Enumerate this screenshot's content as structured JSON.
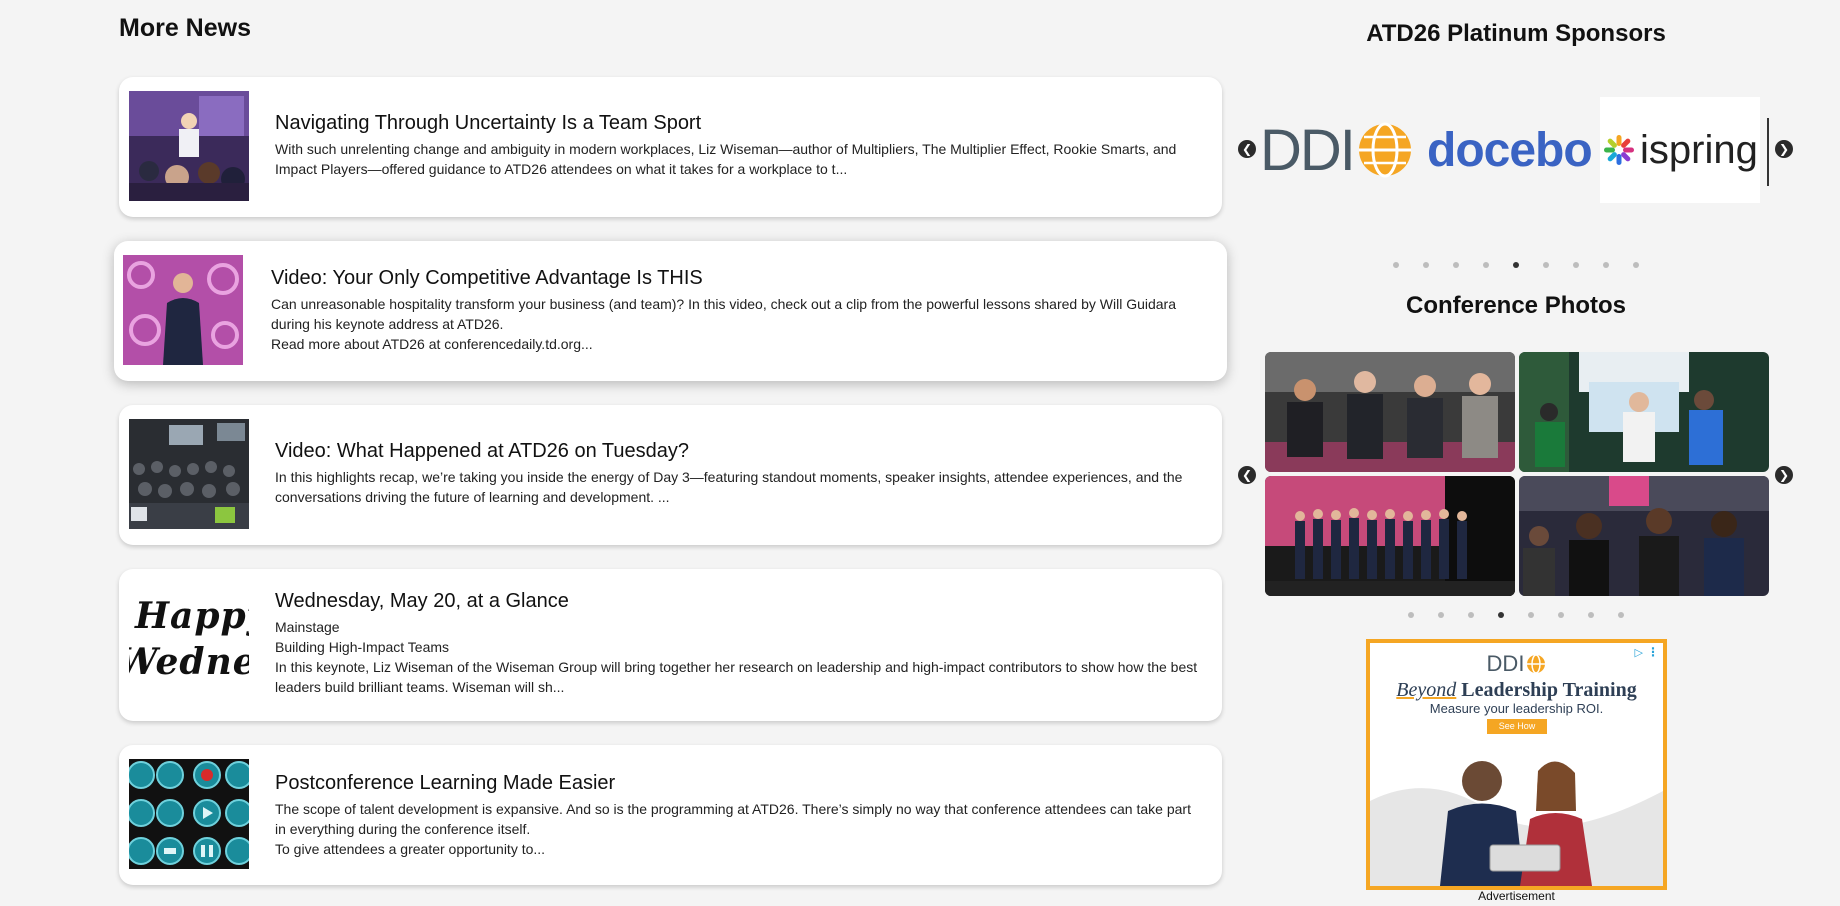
{
  "more_news": {
    "title": "More News",
    "items": [
      {
        "title": "Navigating Through Uncertainty Is a Team Sport",
        "body": [
          "With such unrelenting change and ambiguity in modern workplaces, Liz Wiseman—author of Multipliers, The Multiplier Effect, Rookie Smarts, and Impact Players—offered guidance to ATD26 attendees on what it takes for a workplace to t..."
        ]
      },
      {
        "title": "Video: Your Only Competitive Advantage Is THIS",
        "body": [
          "Can unreasonable hospitality transform your business (and team)? In this video, check out a clip from the powerful lessons shared by Will Guidara during his keynote address at ATD26.",
          "Read more about ATD26 at conferencedaily.td.org..."
        ]
      },
      {
        "title": "Video: What Happened at ATD26 on Tuesday?",
        "body": [
          "In this highlights recap, we’re taking you inside the energy of Day 3—featuring standout moments, speaker insights, attendee experiences, and the conversations driving the future of learning and development. ..."
        ]
      },
      {
        "title": "Wednesday, May 20, at a Glance",
        "body": [
          "Mainstage",
          "Building High-Impact Teams",
          "In this keynote, Liz Wiseman of the Wiseman Group will bring together her research on leadership and high-impact contributors to show how the best leaders build brilliant teams. Wiseman will sh..."
        ]
      },
      {
        "title": "Postconference Learning Made Easier",
        "body": [
          "The scope of talent development is expansive. And so is the programming at ATD26. There’s simply no way that conference attendees can take part in everything during the conference itself.",
          "To give attendees a greater opportunity to..."
        ]
      }
    ],
    "thumb_text": {
      "wednesday": [
        "Happy",
        "Wednesday"
      ]
    }
  },
  "sponsors": {
    "title": "ATD26 Platinum Sponsors",
    "logos": [
      "DDI",
      "docebo",
      "ispring"
    ],
    "dot_count": 9,
    "active_dot": 5
  },
  "photos": {
    "title": "Conference Photos",
    "dot_count": 8,
    "active_dot": 4
  },
  "ad": {
    "brand": "DDI",
    "headline_italic": "Beyond",
    "headline_rest": "Leadership Training",
    "subline": "Measure your leadership ROI.",
    "cta": "See How",
    "label": "Advertisement"
  },
  "colors": {
    "ddi_gray": "#4a5a66",
    "ddi_orange": "#f5a623",
    "docebo_blue": "#3a63c3",
    "ad_border": "#f5a623",
    "ad_headline": "#2e3f55"
  },
  "icons": {
    "prev": "chevron-left-icon",
    "next": "chevron-right-icon",
    "ad_choices": "ad-choices-icon"
  }
}
